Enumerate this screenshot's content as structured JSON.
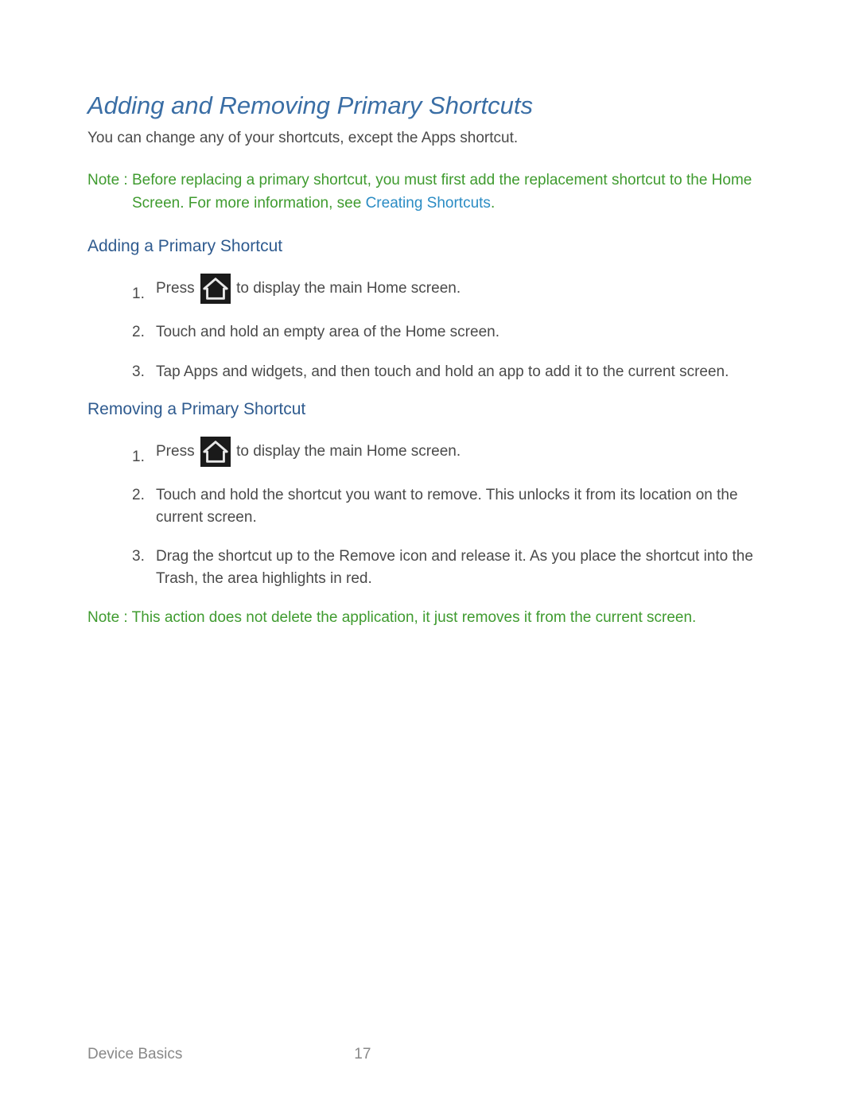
{
  "title": "Adding and Removing Primary Shortcuts",
  "intro": "You can change any of your shortcuts, except the Apps shortcut.",
  "note1": {
    "label": "Note : ",
    "text1": "Before replacing a primary shortcut, you must first add the replacement shortcut to the Home Screen. For more information, see ",
    "link": "Creating Shortcuts",
    "text2": "."
  },
  "section1": {
    "heading": "Adding a Primary Shortcut",
    "steps": {
      "s1a": "Press ",
      "s1b": " to display the main Home screen.",
      "s2": "Touch and hold an empty area of the Home screen.",
      "s3": "Tap Apps and widgets,   and then touch and hold an app to add it to the current screen."
    }
  },
  "section2": {
    "heading": "Removing a Primary Shortcut",
    "steps": {
      "s1a": "Press ",
      "s1b": " to display the main Home screen.",
      "s2": "Touch and hold the shortcut you want to remove. This unlocks it from its location on the current screen.",
      "s3": "Drag the shortcut up to the Remove icon and release it.  As you place the shortcut into the Trash, the area highlights in red."
    }
  },
  "note2": {
    "label": "Note : ",
    "text": "This action does not delete the application, it just removes it from the current screen."
  },
  "footer": {
    "section": "Device Basics",
    "page": "17"
  }
}
